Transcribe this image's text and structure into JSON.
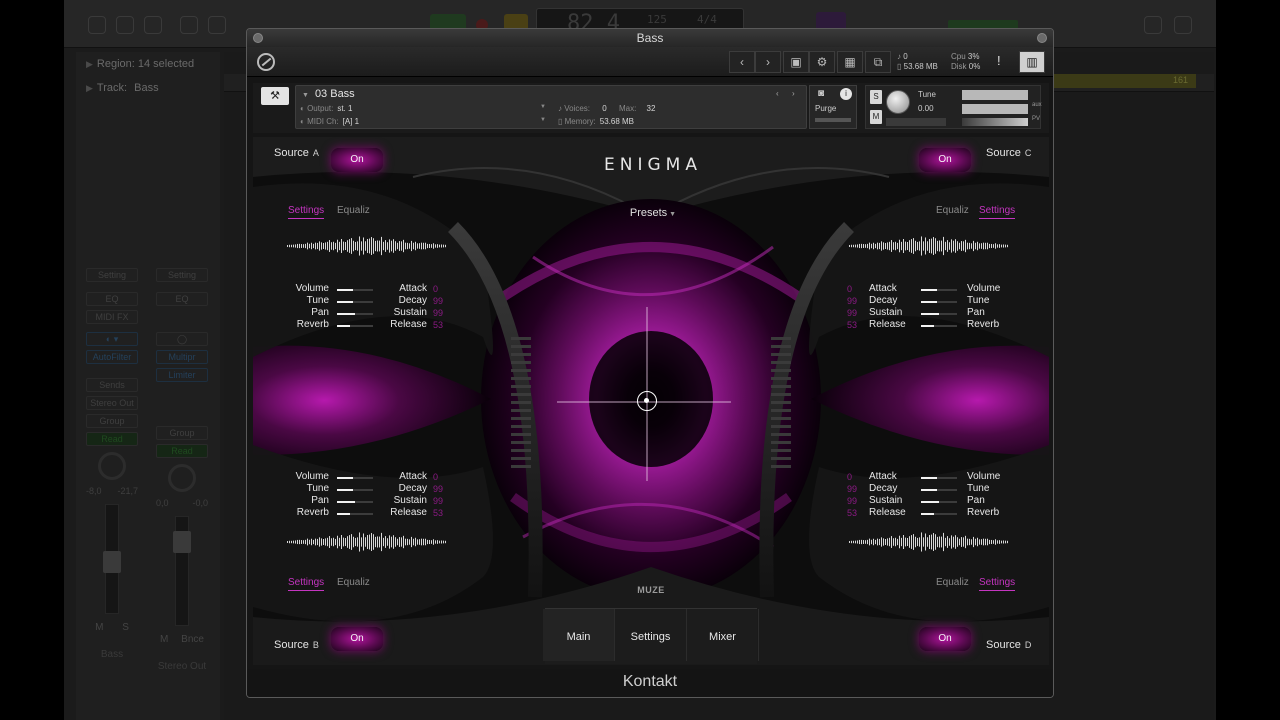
{
  "daw": {
    "lcd_position": "82 4",
    "lcd_tempo": "125",
    "lcd_signature": "4/4",
    "inspector_region": "Region: 14 selected",
    "inspector_track_label": "Track:",
    "inspector_track_value": "Bass",
    "strip1": {
      "setting": "Setting",
      "eq": "EQ",
      "midi_fx": "MIDI FX",
      "plugin": "AutoFilter",
      "sends": "Sends",
      "output": "Stereo Out",
      "group": "Group",
      "automation": "Read",
      "pan_l": "-8,0",
      "pan_r": "-21,7",
      "m": "M",
      "s": "S",
      "name": "Bass"
    },
    "strip2": {
      "setting": "Setting",
      "eq": "EQ",
      "plugin1": "Multipr",
      "plugin2": "Limiter",
      "group": "Group",
      "automation": "Read",
      "pan_l": "0,0",
      "pan_r": "-0,0",
      "m": "M",
      "bounce": "Bnce",
      "name": "Stereo Out"
    },
    "region_label": "161"
  },
  "kontakt": {
    "window_title": "Bass",
    "footer": "Kontakt",
    "toolbar": {
      "prev_icon": "chevron-left-icon",
      "next_icon": "chevron-right-icon",
      "voices_value": "0",
      "memory_value": "53.68 MB",
      "cpu_label": "Cpu",
      "cpu_value": "3%",
      "disk_label": "Disk",
      "disk_value": "0%",
      "alert": "!"
    },
    "instrument": {
      "name": "03 Bass",
      "output_label": "Output:",
      "output_value": "st. 1",
      "midi_label": "MIDI Ch:",
      "midi_value": "[A] 1",
      "voices_label": "Voices:",
      "voices_value": "0",
      "max_label": "Max:",
      "max_value": "32",
      "memory_label": "Memory:",
      "memory_value": "53.68 MB",
      "purge_label": "Purge",
      "tune_label": "Tune",
      "tune_value": "0.00",
      "solo": "S",
      "mute": "M",
      "pv_label": "PV",
      "aux_label": "aux"
    }
  },
  "panel": {
    "brand": "ENIGMA",
    "presets_label": "Presets",
    "maker": "MUZE",
    "nav": [
      "Main",
      "Settings",
      "Mixer"
    ],
    "on_label": "On",
    "tab_settings": "Settings",
    "tab_equaliz": "Equaliz",
    "sources": [
      {
        "label": "Source",
        "letter": "A"
      },
      {
        "label": "Source",
        "letter": "B"
      },
      {
        "label": "Source",
        "letter": "C"
      },
      {
        "label": "Source",
        "letter": "D"
      }
    ],
    "params_left": [
      "Volume",
      "Tune",
      "Pan",
      "Reverb"
    ],
    "params_env": [
      "Attack",
      "Decay",
      "Sustain",
      "Release"
    ],
    "levels": {
      "volume": 0.45,
      "tune": 0.45,
      "pan": 0.5,
      "reverb": 0.35
    },
    "env_values": {
      "attack": "0",
      "decay": "99",
      "sustain": "99",
      "release": "53"
    },
    "accent_color": "#c435c0"
  }
}
